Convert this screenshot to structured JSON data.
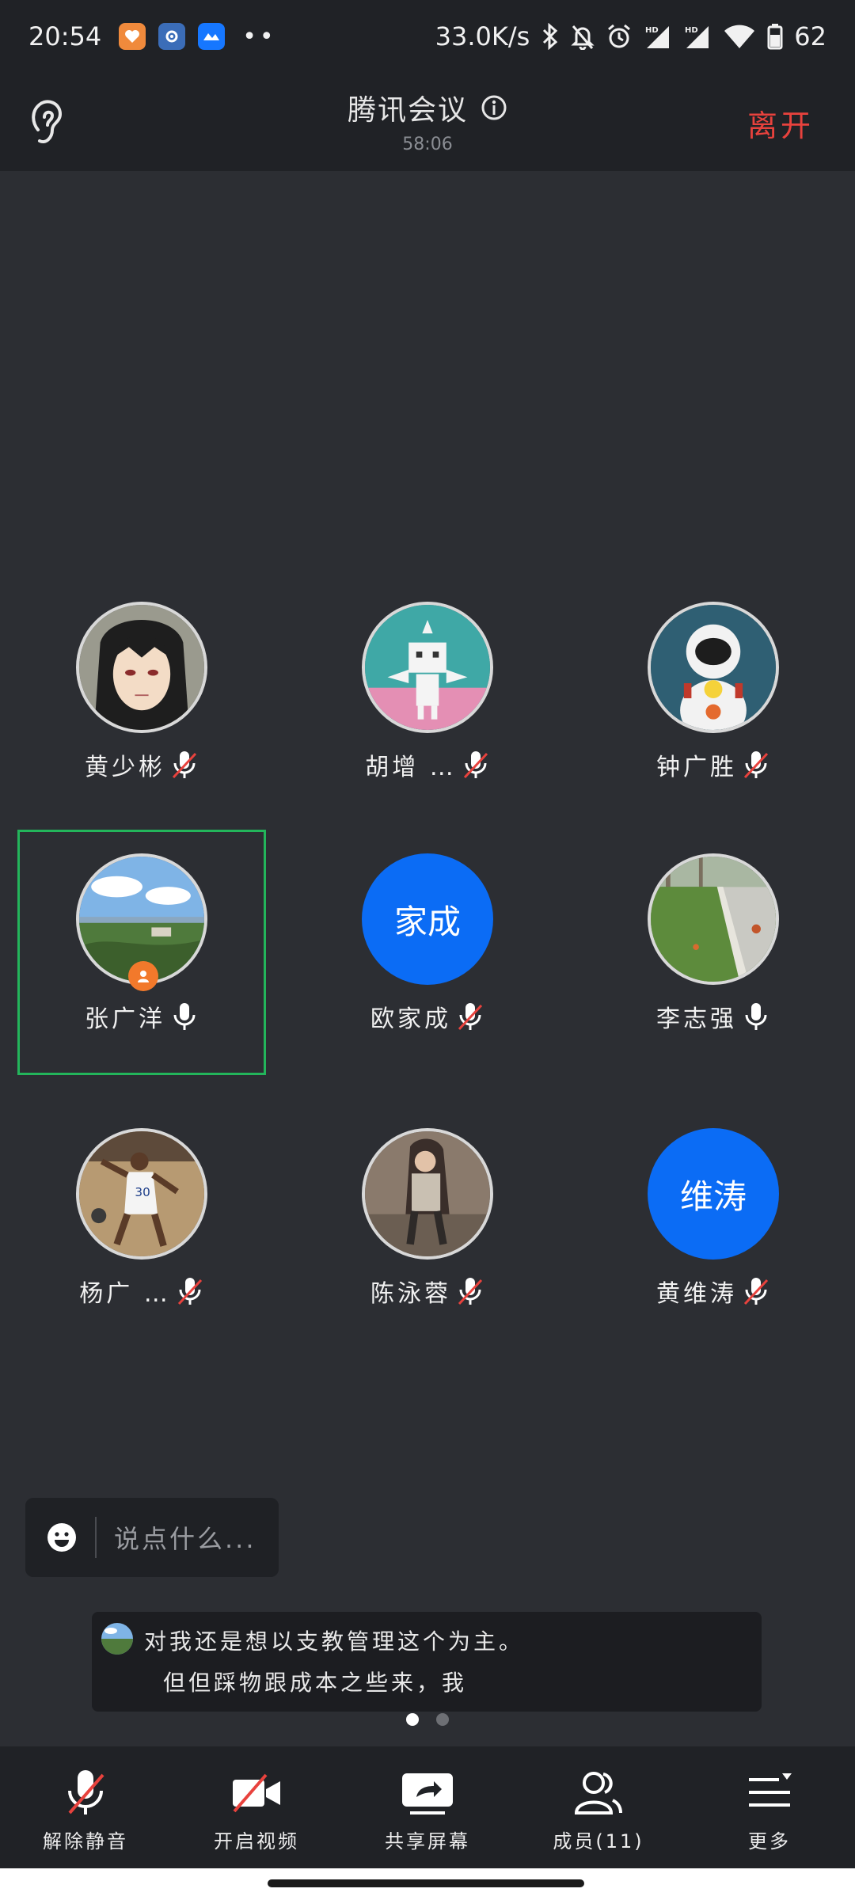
{
  "status_bar": {
    "time": "20:54",
    "net_speed": "33.0K/s",
    "battery": "62"
  },
  "header": {
    "title": "腾讯会议",
    "timer": "58:06",
    "leave_label": "离开"
  },
  "participants": [
    {
      "name": "黄少彬",
      "muted": true
    },
    {
      "name": "胡增 …",
      "muted": true
    },
    {
      "name": "钟广胜",
      "muted": true
    },
    {
      "name": "张广洋",
      "muted": false,
      "host": true,
      "active": true
    },
    {
      "name": "欧家成",
      "muted": true,
      "avatar_text": "家成"
    },
    {
      "name": "李志强",
      "muted": false
    },
    {
      "name": "杨广 …",
      "muted": true
    },
    {
      "name": "陈泳蓉",
      "muted": true
    },
    {
      "name": "黄维涛",
      "muted": true,
      "avatar_text": "维涛"
    }
  ],
  "chat": {
    "placeholder": "说点什么..."
  },
  "caption": {
    "line1": "对我还是想以支教管理这个为主。",
    "line2": "但但踩物跟成本之些来，我"
  },
  "toolbar": {
    "unmute": "解除静音",
    "video": "开启视频",
    "share": "共享屏幕",
    "members": "成员(11)",
    "more": "更多"
  },
  "colors": {
    "accent_blue": "#0b6cf5",
    "leave_red": "#e8423d",
    "active_green": "#23b55b",
    "host_orange": "#f2792b"
  }
}
